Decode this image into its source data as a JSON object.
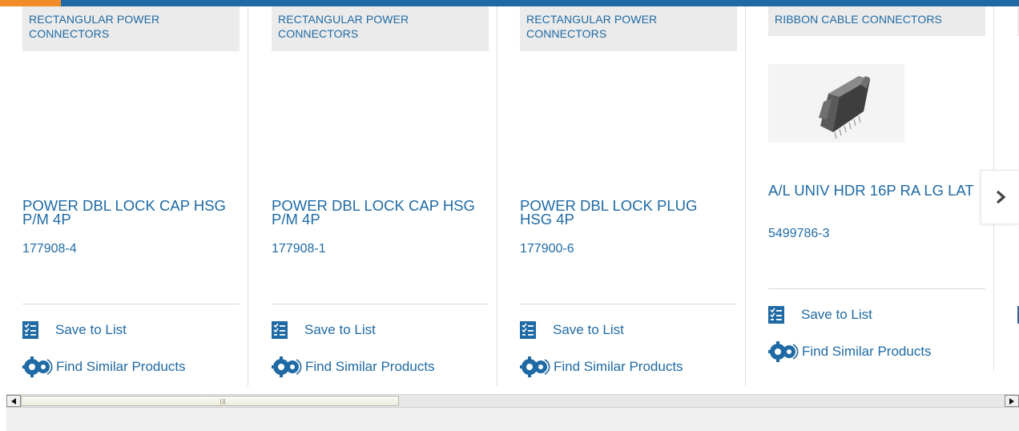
{
  "products": [
    {
      "category": "RECTANGULAR POWER CONNECTORS",
      "title": "POWER DBL LOCK CAP HSG P/M 4P",
      "part_number": "177908-4",
      "has_image": false
    },
    {
      "category": "RECTANGULAR POWER CONNECTORS",
      "title": "POWER DBL LOCK CAP HSG P/M 4P",
      "part_number": "177908-1",
      "has_image": false
    },
    {
      "category": "RECTANGULAR POWER CONNECTORS",
      "title": "POWER DBL LOCK PLUG HSG 4P",
      "part_number": "177900-6",
      "has_image": false
    },
    {
      "category": "RIBBON CABLE CONNECTORS",
      "title": "A/L UNIV HDR 16P RA LG LAT",
      "part_number": "5499786-3",
      "has_image": true
    }
  ],
  "actions": {
    "save_label": "Save to List",
    "similar_label": "Find Similar Products"
  },
  "colors": {
    "brand_blue": "#1f6aa5",
    "accent_orange": "#f28c28",
    "category_bg": "#ebebeb"
  },
  "icons": {
    "save": "checklist-icon",
    "similar": "gears-icon",
    "next": "chevron-right-icon"
  }
}
